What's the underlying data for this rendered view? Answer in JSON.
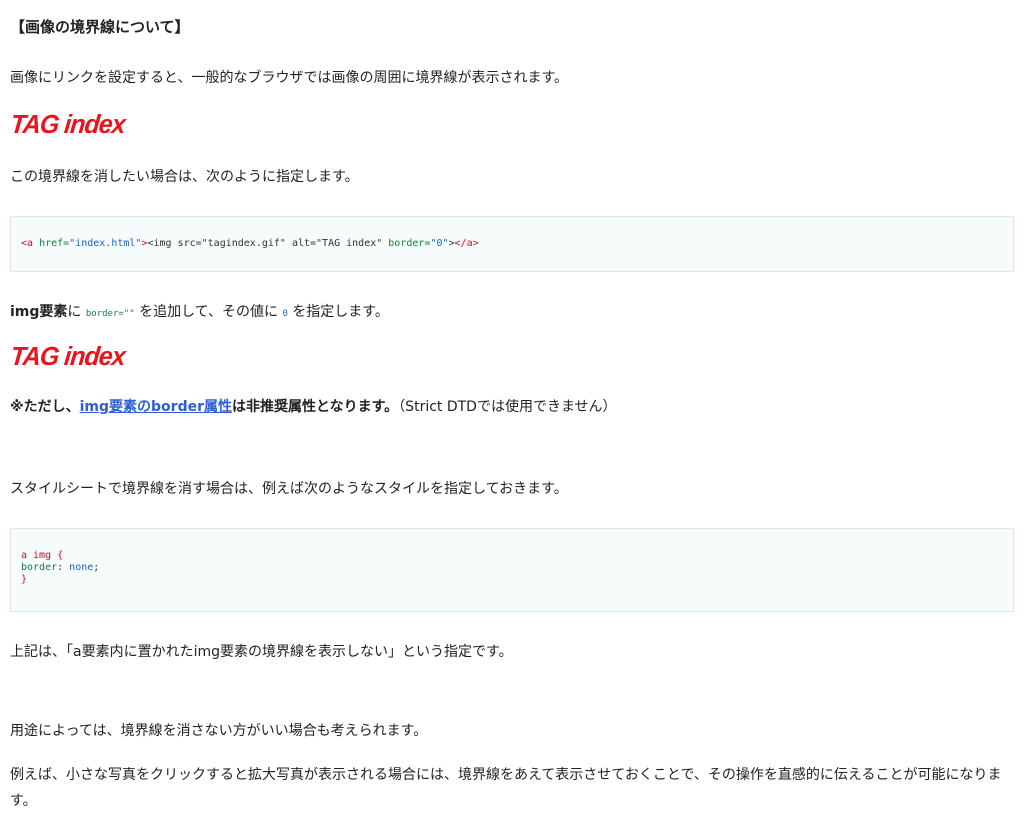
{
  "title": "【画像の境界線について】",
  "intro": "画像にリンクを設定すると、一般的なブラウザでは画像の周囲に境界線が表示されます。",
  "logo1": "TAG index",
  "remove_text": "この境界線を消したい場合は、次のように指定します。",
  "code1": {
    "a_open": "<a",
    "href_attr": " href=",
    "href_val": "\"index.html\"",
    "a_close_gt": ">",
    "img_open": "<img src=\"tagindex.gif\" alt=\"TAG index\"",
    "border_attr": " border=",
    "border_val": "\"0\"",
    "img_close": ">",
    "a_end": "</a>"
  },
  "explain": {
    "img_label": "img要素",
    "ni": "に ",
    "border_code": "border=\"\"",
    "add_text": " を追加して、その値に ",
    "zero_code": "0",
    "end_text": " を指定します。"
  },
  "logo2": "TAG index",
  "note": {
    "prefix": "※ただし、",
    "link_text": "img要素のborder属性",
    "suffix": "は非推奨属性となります。",
    "paren": "（Strict DTDでは使用できません）"
  },
  "stylesheet_text": "スタイルシートで境界線を消す場合は、例えば次のようなスタイルを指定しておきます。",
  "code2": {
    "line1": "a img {",
    "line2_prop": "border",
    "line2_colon": ": ",
    "line2_val": "none",
    "line2_semi": ";",
    "line3": "}"
  },
  "summary": "上記は、「a要素内に置かれたimg要素の境界線を表示しない」という指定です。",
  "usage": "用途によっては、境界線を消さない方がいい場合も考えられます。",
  "example": "例えば、小さな写真をクリックすると拡大写真が表示される場合には、境界線をあえて表示させておくことで、その操作を直感的に伝えることが可能になります。"
}
